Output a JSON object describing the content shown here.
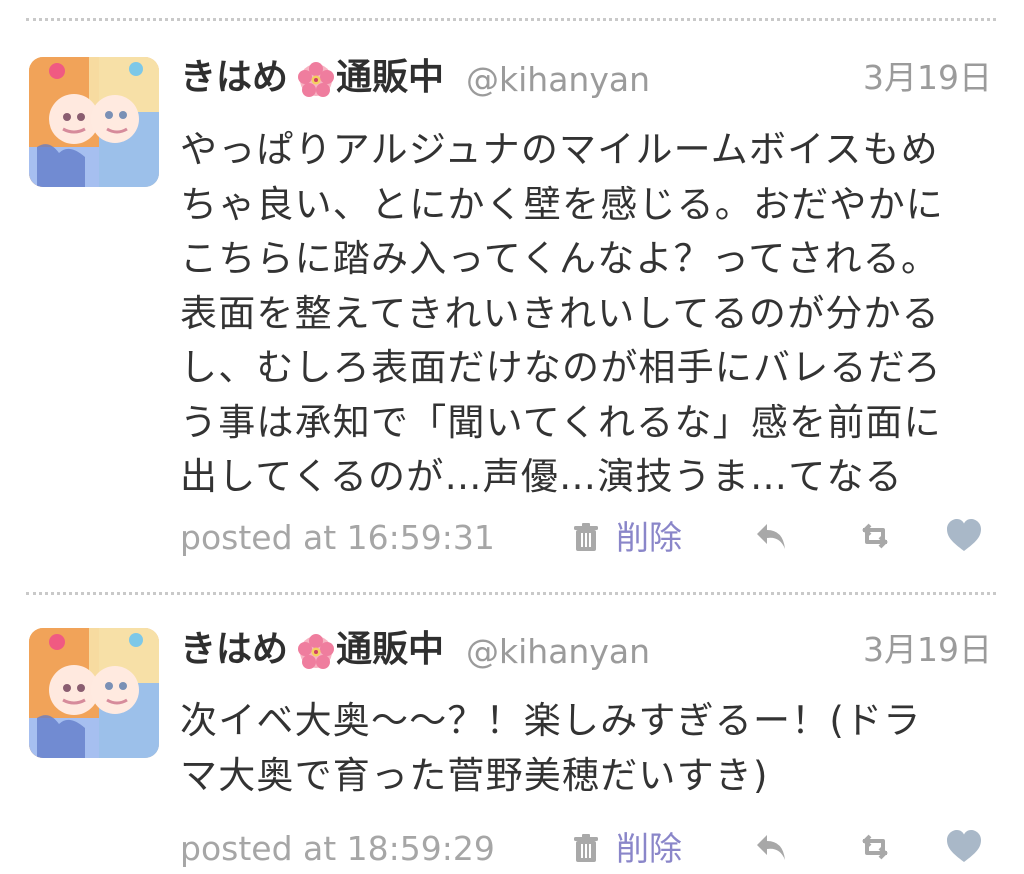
{
  "tweets": [
    {
      "display_name": "きはめ",
      "display_name_suffix": "通販中",
      "flower_emoji": "🌺",
      "handle": "@kihanyan",
      "date": "3月19日",
      "text": "やっぱりアルジュナのマイルームボイスもめ\nちゃ良い、とにかく壁を感じる。おだやかに\nこちらに踏み入ってくんなよ？ってされる。\n表面を整えてきれいきれいしてるのが分かる\nし、むしろ表面だけなのが相手にバレるだろ\nう事は承知で「聞いてくれるな」感を前面に\n出してくるのが…声優…演技うま…てなる",
      "posted_at": "posted at 16:59:31",
      "delete_label": "削除",
      "icons": [
        "trash-icon",
        "reply-icon",
        "retweet-icon",
        "favorite-heart-icon"
      ]
    },
    {
      "display_name": "きはめ",
      "display_name_suffix": "通販中",
      "flower_emoji": "🌺",
      "handle": "@kihanyan",
      "date": "3月19日",
      "text": "次イベ大奥～～？！楽しみすぎるー！(ドラ\nマ大奥で育った菅野美穂だいすき)",
      "posted_at": "posted at 18:59:29",
      "delete_label": "削除",
      "icons": [
        "trash-icon",
        "reply-icon",
        "retweet-icon",
        "favorite-heart-icon"
      ]
    }
  ],
  "colors": {
    "text": "#333333",
    "muted": "#9b9b9b",
    "delete_link": "#8a86c9",
    "icon": "#a9b8c8",
    "divider": "#c9c9c9"
  }
}
